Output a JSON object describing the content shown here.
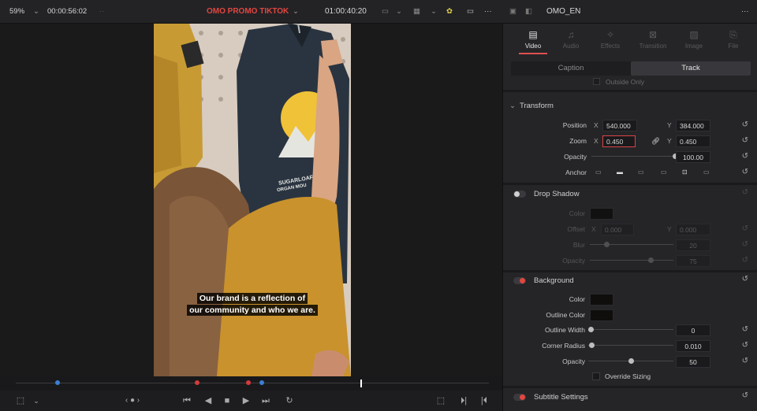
{
  "topbar": {
    "zoom": "59%",
    "source_timecode": "00:00:56:02",
    "timeline_name": "OMO PROMO TIKTOK",
    "record_timecode": "01:00:40:20",
    "inspector_title": "OMO_EN",
    "accent_color": "#e2463f"
  },
  "video": {
    "caption_line1": "Our brand is a reflection of",
    "caption_line2": "our community and who we are.",
    "shirt_text_1": "SUGARLOAF",
    "shirt_text_2": "ORGAN MOU"
  },
  "inspector": {
    "tabs": [
      {
        "label": "Video",
        "icon": "video-icon",
        "active": true
      },
      {
        "label": "Audio",
        "icon": "audio-icon",
        "active": false
      },
      {
        "label": "Effects",
        "icon": "effects-icon",
        "active": false
      },
      {
        "label": "Transition",
        "icon": "transition-icon",
        "active": false
      },
      {
        "label": "Image",
        "icon": "image-icon",
        "active": false
      },
      {
        "label": "File",
        "icon": "file-icon",
        "active": false
      }
    ],
    "subtabs": {
      "caption": "Caption",
      "track": "Track"
    },
    "outside_only": "Outside Only",
    "transform": {
      "title": "Transform",
      "position_label": "Position",
      "position_x": "540.000",
      "position_y": "384.000",
      "zoom_label": "Zoom",
      "zoom_x": "0.450",
      "zoom_y": "0.450",
      "opacity_label": "Opacity",
      "opacity_value": "100.00",
      "opacity_level": 1.0,
      "anchor_label": "Anchor",
      "axis_x": "X",
      "axis_y": "Y"
    },
    "drop_shadow": {
      "title": "Drop Shadow",
      "color_label": "Color",
      "offset_label": "Offset",
      "offset_x": "0.000",
      "offset_y": "0.000",
      "blur_label": "Blur",
      "blur_value": "20",
      "blur_level": 0.2,
      "opacity_label": "Opacity",
      "opacity_value": "75",
      "opacity_level": 0.75,
      "enabled": false
    },
    "background": {
      "title": "Background",
      "color_label": "Color",
      "outline_color_label": "Outline Color",
      "outline_width_label": "Outline Width",
      "outline_width_value": "0",
      "corner_radius_label": "Corner Radius",
      "corner_radius_value": "0.010",
      "opacity_label": "Opacity",
      "opacity_value": "50",
      "opacity_level": 0.5,
      "override_sizing_label": "Override Sizing",
      "enabled": true
    },
    "subtitle_settings": {
      "title": "Subtitle Settings",
      "enabled": true
    }
  }
}
